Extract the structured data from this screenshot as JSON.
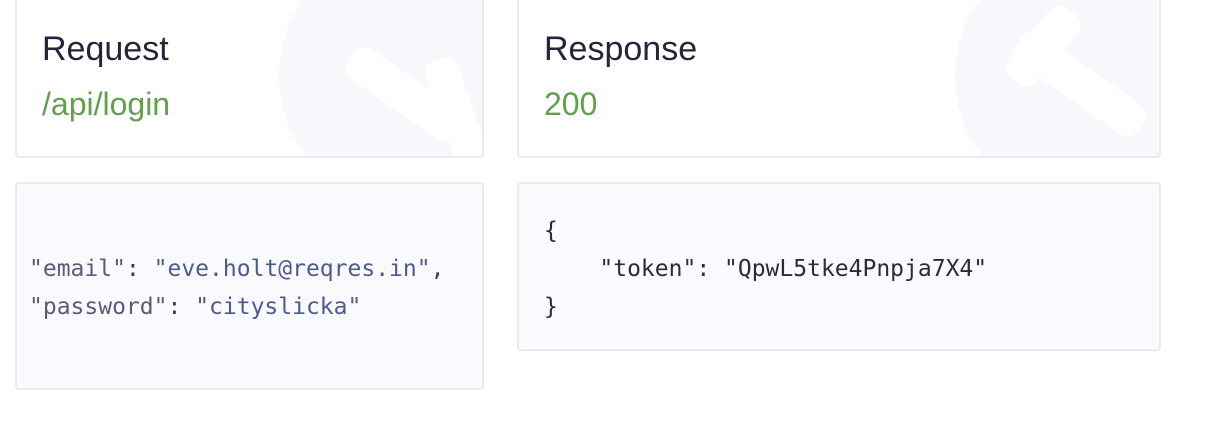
{
  "request": {
    "title": "Request",
    "endpoint": "/api/login",
    "body": {
      "email_key": "\"email\"",
      "email_sep": ": ",
      "email_value": "\"eve.holt@reqres.in\"",
      "email_trailer": ",",
      "password_key": "\"password\"",
      "password_sep": ": ",
      "password_value": "\"cityslicka\""
    }
  },
  "response": {
    "title": "Response",
    "status": "200",
    "body": {
      "open": "{",
      "token_line": "    \"token\": \"QpwL5tke4Pnpja7X4\"",
      "close": "}"
    }
  }
}
